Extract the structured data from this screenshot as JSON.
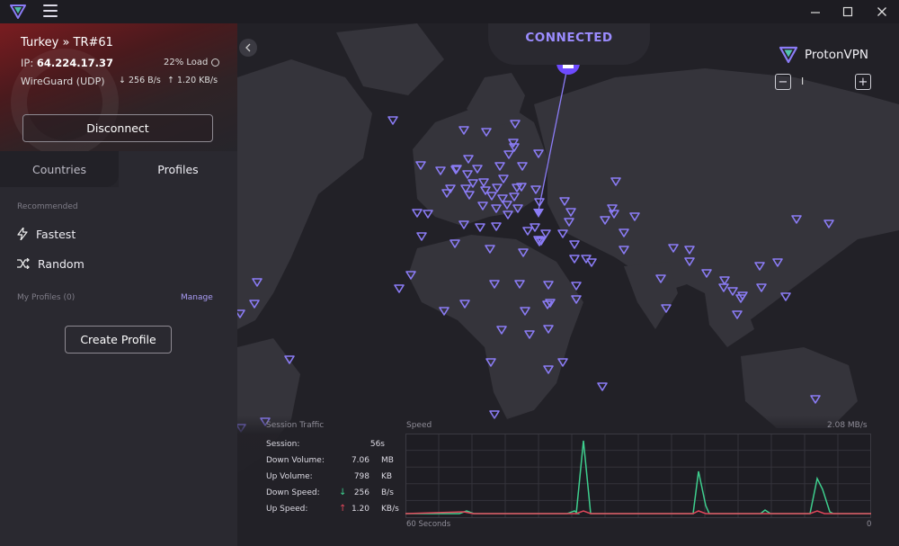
{
  "window": {
    "logo_icon": "protonvpn-logo-icon",
    "menu_icon": "hamburger-menu-icon",
    "controls": [
      "minimize-icon",
      "maximize-icon",
      "close-icon"
    ]
  },
  "connection": {
    "server": "Turkey » TR#61",
    "ip_label": "IP: ",
    "ip": "64.224.17.37",
    "load": "22% Load",
    "protocol": "WireGuard (UDP)",
    "down_rate": "↓ 256 B/s",
    "up_rate": "↑ 1.20 KB/s",
    "disconnect_label": "Disconnect",
    "flag_color": "#7a1c20"
  },
  "tabs": [
    {
      "label": "Countries",
      "active": false
    },
    {
      "label": "Profiles",
      "active": true
    }
  ],
  "profiles": {
    "recommended_label": "Recommended",
    "items": [
      {
        "label": "Fastest",
        "icon": "lightning-icon"
      },
      {
        "label": "Random",
        "icon": "shuffle-icon"
      }
    ],
    "my_profiles_label": "My Profiles (0)",
    "manage_label": "Manage",
    "create_label": "Create Profile"
  },
  "map": {
    "status": "CONNECTED",
    "brand": "ProtonVPN",
    "zoom_out": "−",
    "zoom_level": "I",
    "zoom_in": "+",
    "accent_color": "#8b7cf6",
    "home_icon": "home-icon",
    "server_marker_icon": "server-triangle-icon"
  },
  "traffic": {
    "title": "Session Traffic",
    "stats": [
      {
        "label": "Session:",
        "value": "56s",
        "unit": ""
      },
      {
        "label": "Down Volume:",
        "value": "7.06",
        "unit": "MB"
      },
      {
        "label": "Up Volume:",
        "value": "798",
        "unit": "KB"
      },
      {
        "label": "Down Speed:",
        "value": "256",
        "unit": "B/s"
      },
      {
        "label": "Up Speed:",
        "value": "1.20",
        "unit": "KB/s"
      }
    ],
    "down_color": "#3ecf8e",
    "up_color": "#e0475b",
    "speed_label": "Speed",
    "speed_max": "2.08 MB/s",
    "x_label": "60 Seconds",
    "x_end": "0"
  }
}
